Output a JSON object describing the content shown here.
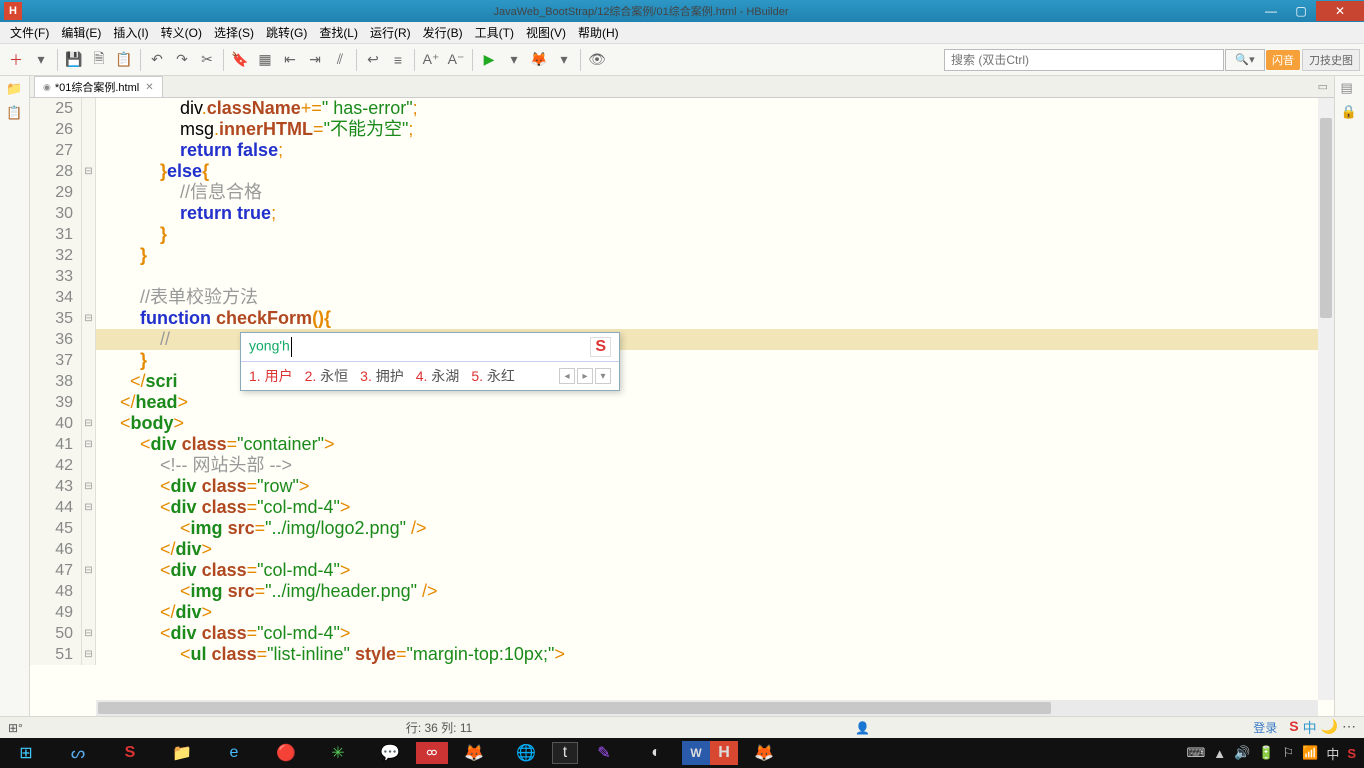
{
  "title": "JavaWeb_BootStrap/12综合案例/01综合案例.html - HBuilder",
  "app_icon_letter": "H",
  "menus": [
    "文件(F)",
    "编辑(E)",
    "插入(I)",
    "转义(O)",
    "选择(S)",
    "跳转(G)",
    "查找(L)",
    "运行(R)",
    "发行(B)",
    "工具(T)",
    "视图(V)",
    "帮助(H)"
  ],
  "search_placeholder": "搜索 (双击Ctrl)",
  "tab": {
    "name": "*01综合案例.html",
    "close": "✕"
  },
  "right_badges": {
    "a": "闪音",
    "b": "刀技史图"
  },
  "ime": {
    "input": "yong'h",
    "brand": "S",
    "candidates": [
      {
        "n": "1.",
        "t": "用户"
      },
      {
        "n": "2.",
        "t": "永恒"
      },
      {
        "n": "3.",
        "t": "拥护"
      },
      {
        "n": "4.",
        "t": "永湖"
      },
      {
        "n": "5.",
        "t": "永红"
      }
    ]
  },
  "status": {
    "pos": "行: 36 列: 11",
    "login": "登录"
  },
  "lines": [
    {
      "n": "25",
      "fold": "",
      "html": "                div<span class='punc'>.</span><span class='fn'>className</span><span class='punc'>+=</span><span class='str'>\" has-error\"</span><span class='punc'>;</span>"
    },
    {
      "n": "26",
      "fold": "",
      "html": "                msg<span class='punc'>.</span><span class='fn'>innerHTML</span><span class='punc'>=</span><span class='str'>\"不能为空\"</span><span class='punc'>;</span>"
    },
    {
      "n": "27",
      "fold": "",
      "html": "                <span class='kw'>return</span> <span class='kw'>false</span><span class='punc'>;</span>"
    },
    {
      "n": "28",
      "fold": "⊟",
      "html": "            <span class='br'>}</span><span class='kw'>else</span><span class='br'>{</span>"
    },
    {
      "n": "29",
      "fold": "",
      "html": "                <span class='com'>//信息合格</span>"
    },
    {
      "n": "30",
      "fold": "",
      "html": "                <span class='kw'>return</span> <span class='kw'>true</span><span class='punc'>;</span>"
    },
    {
      "n": "31",
      "fold": "",
      "html": "            <span class='br'>}</span>"
    },
    {
      "n": "32",
      "fold": "",
      "html": "        <span class='br'>}</span>"
    },
    {
      "n": "33",
      "fold": "",
      "html": " "
    },
    {
      "n": "34",
      "fold": "",
      "html": "        <span class='com'>//表单校验方法</span>"
    },
    {
      "n": "35",
      "fold": "⊟",
      "html": "        <span class='kw'>function</span> <span class='fn'>checkForm</span><span class='br'>(){</span>"
    },
    {
      "n": "36",
      "fold": "",
      "html": "            <span class='com'>//</span>",
      "hl": true
    },
    {
      "n": "37",
      "fold": "",
      "html": "        <span class='br'>}</span>"
    },
    {
      "n": "38",
      "fold": "",
      "html": "      <span class='punc'>&lt;/</span><span class='tag'>scri</span>"
    },
    {
      "n": "39",
      "fold": "",
      "html": "    <span class='punc'>&lt;/</span><span class='tag'>head</span><span class='punc'>&gt;</span>"
    },
    {
      "n": "40",
      "fold": "⊟",
      "html": "    <span class='punc'>&lt;</span><span class='tag'>body</span><span class='punc'>&gt;</span>"
    },
    {
      "n": "41",
      "fold": "⊟",
      "html": "        <span class='punc'>&lt;</span><span class='tag'>div</span> <span class='attr'>class</span><span class='punc'>=</span><span class='str'>\"container\"</span><span class='punc'>&gt;</span>"
    },
    {
      "n": "42",
      "fold": "",
      "html": "            <span class='com'>&lt;!-- 网站头部 --&gt;</span>"
    },
    {
      "n": "43",
      "fold": "⊟",
      "html": "            <span class='punc'>&lt;</span><span class='tag'>div</span> <span class='attr'>class</span><span class='punc'>=</span><span class='str'>\"row\"</span><span class='punc'>&gt;</span>"
    },
    {
      "n": "44",
      "fold": "⊟",
      "html": "            <span class='punc'>&lt;</span><span class='tag'>div</span> <span class='attr'>class</span><span class='punc'>=</span><span class='str'>\"col-md-4\"</span><span class='punc'>&gt;</span>"
    },
    {
      "n": "45",
      "fold": "",
      "html": "                <span class='punc'>&lt;</span><span class='tag'>img</span> <span class='attr'>src</span><span class='punc'>=</span><span class='str'>\"../img/logo2.png\"</span> <span class='punc'>/&gt;</span>"
    },
    {
      "n": "46",
      "fold": "",
      "html": "            <span class='punc'>&lt;/</span><span class='tag'>div</span><span class='punc'>&gt;</span>"
    },
    {
      "n": "47",
      "fold": "⊟",
      "html": "            <span class='punc'>&lt;</span><span class='tag'>div</span> <span class='attr'>class</span><span class='punc'>=</span><span class='str'>\"col-md-4\"</span><span class='punc'>&gt;</span>"
    },
    {
      "n": "48",
      "fold": "",
      "html": "                <span class='punc'>&lt;</span><span class='tag'>img</span> <span class='attr'>src</span><span class='punc'>=</span><span class='str'>\"../img/header.png\"</span> <span class='punc'>/&gt;</span>"
    },
    {
      "n": "49",
      "fold": "",
      "html": "            <span class='punc'>&lt;/</span><span class='tag'>div</span><span class='punc'>&gt;</span>"
    },
    {
      "n": "50",
      "fold": "⊟",
      "html": "            <span class='punc'>&lt;</span><span class='tag'>div</span> <span class='attr'>class</span><span class='punc'>=</span><span class='str'>\"col-md-4\"</span><span class='punc'>&gt;</span>"
    },
    {
      "n": "51",
      "fold": "⊟",
      "html": "                <span class='punc'>&lt;</span><span class='tag'>ul</span> <span class='attr'>class</span><span class='punc'>=</span><span class='str'>\"list-inline\"</span> <span class='attr'>style</span><span class='punc'>=</span><span class='str'>\"margin-top:10px;\"</span><span class='punc'>&gt;</span>"
    }
  ]
}
